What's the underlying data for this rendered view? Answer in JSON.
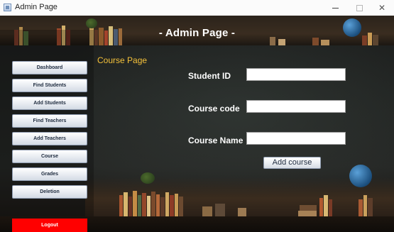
{
  "window": {
    "title": "Admin Page",
    "minimize_glyph": "",
    "maximize_glyph": "",
    "close_glyph": "✕"
  },
  "header": {
    "title": "- Admin Page -"
  },
  "sidebar": {
    "items": [
      {
        "label": "Dashboard"
      },
      {
        "label": "Find Students"
      },
      {
        "label": "Add Students"
      },
      {
        "label": "Find Teachers"
      },
      {
        "label": "Add Teachers"
      },
      {
        "label": "Course"
      },
      {
        "label": "Grades"
      },
      {
        "label": "Deletion"
      }
    ],
    "logout_label": "Logout"
  },
  "main": {
    "section_title": "Course Page",
    "fields": [
      {
        "label": "Student ID",
        "value": ""
      },
      {
        "label": "Course code",
        "value": ""
      },
      {
        "label": "Course Name",
        "value": ""
      }
    ],
    "add_button_label": "Add course"
  },
  "colors": {
    "section_title": "#f4c13a",
    "logout_background": "#ff0000",
    "background": "#222523"
  },
  "icons": {
    "app": "java-window-icon",
    "minimize": "minimize-icon",
    "maximize": "maximize-icon",
    "close": "close-icon"
  }
}
